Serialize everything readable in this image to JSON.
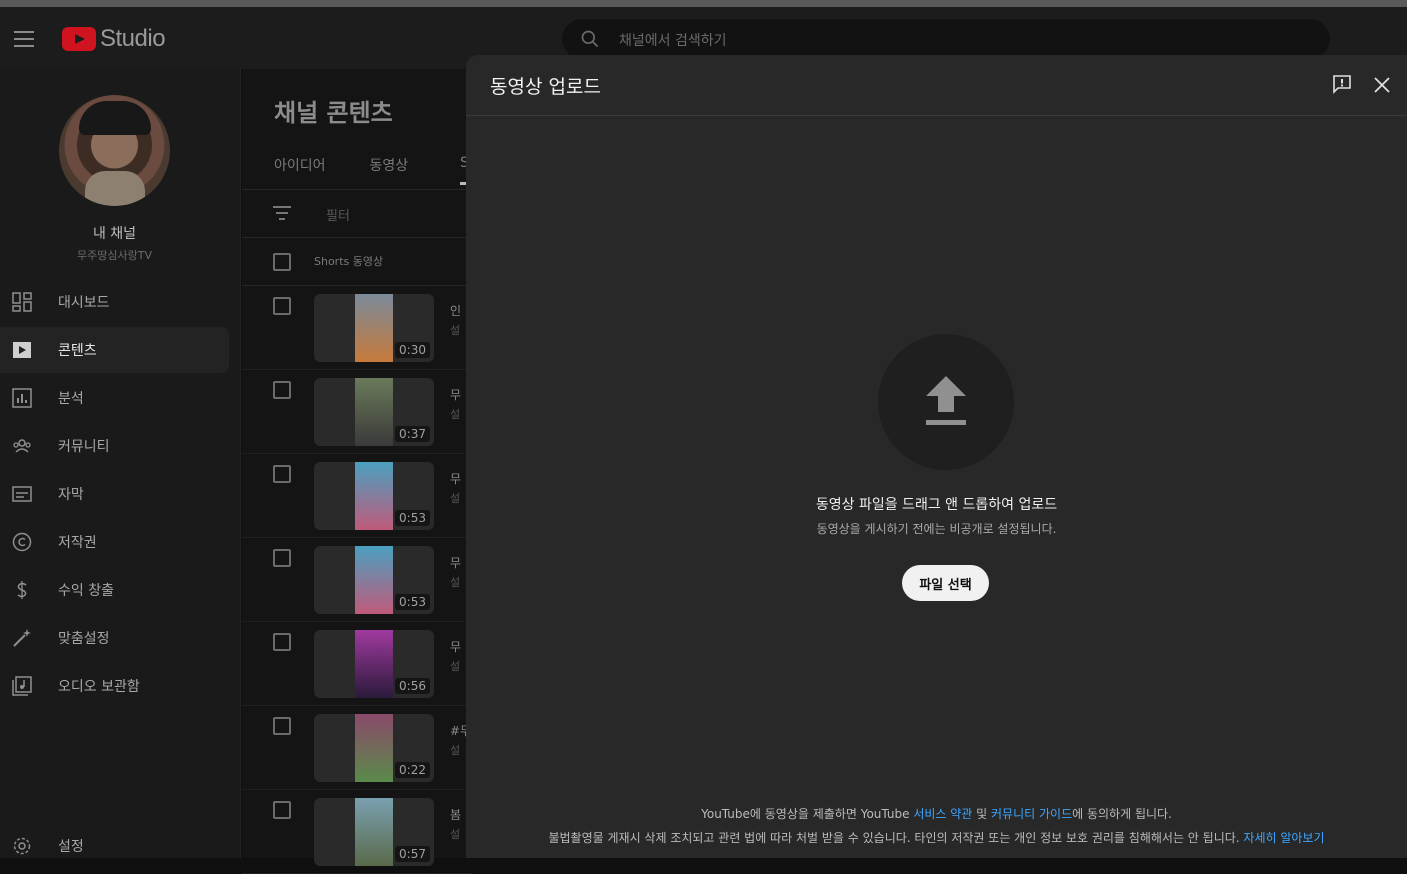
{
  "header": {
    "logo_text": "Studio",
    "search_placeholder": "채널에서 검색하기"
  },
  "sidebar": {
    "channel_name": "내 채널",
    "channel_handle": "무주땅심사랑TV",
    "items": [
      {
        "label": "대시보드",
        "icon": "dashboard-icon"
      },
      {
        "label": "콘텐츠",
        "icon": "content-icon",
        "active": true
      },
      {
        "label": "분석",
        "icon": "analytics-icon"
      },
      {
        "label": "커뮤니티",
        "icon": "community-icon"
      },
      {
        "label": "자막",
        "icon": "subtitles-icon"
      },
      {
        "label": "저작권",
        "icon": "copyright-icon"
      },
      {
        "label": "수익 창출",
        "icon": "monetization-icon"
      },
      {
        "label": "맞춤설정",
        "icon": "customization-icon"
      },
      {
        "label": "오디오 보관함",
        "icon": "audio-library-icon"
      }
    ],
    "settings_label": "설정"
  },
  "main": {
    "title": "채널 콘텐츠",
    "tabs": [
      "아이디어",
      "동영상",
      "S"
    ],
    "filter_label": "필터",
    "list_header": "Shorts 동영상",
    "rows": [
      {
        "duration": "0:30",
        "title": "인",
        "sub": "설",
        "colors": [
          "#7a8a9a",
          "#c77a3a"
        ]
      },
      {
        "duration": "0:37",
        "title": "무",
        "sub": "설",
        "colors": [
          "#6a7a5a",
          "#3a3a3a"
        ]
      },
      {
        "duration": "0:53",
        "title": "무",
        "sub": "설",
        "colors": [
          "#4aa0c0",
          "#c05a7a"
        ]
      },
      {
        "duration": "0:53",
        "title": "무",
        "sub": "설",
        "colors": [
          "#4aa0c0",
          "#c05a7a"
        ]
      },
      {
        "duration": "0:56",
        "title": "무",
        "sub": "설",
        "colors": [
          "#a03aa0",
          "#2a1a3a"
        ]
      },
      {
        "duration": "0:22",
        "title": "#무",
        "sub": "설",
        "colors": [
          "#8a4a6a",
          "#5a8a4a"
        ]
      },
      {
        "duration": "0:57",
        "title": "봄",
        "sub": "설",
        "colors": [
          "#7aa0b0",
          "#5a6a4a"
        ]
      }
    ]
  },
  "dialog": {
    "title": "동영상 업로드",
    "drop_title": "동영상 파일을 드래그 앤 드롭하여 업로드",
    "drop_sub": "동영상을 게시하기 전에는 비공개로 설정됩니다.",
    "select_button": "파일 선택",
    "footer_line1_a": "YouTube에 동영상을 제출하면 YouTube ",
    "footer_link_terms": "서비스 약관",
    "footer_line1_b": " 및 ",
    "footer_link_guidelines": "커뮤니티 가이드",
    "footer_line1_c": "에 동의하게 됩니다.",
    "footer_line2": "불법촬영물 게재시 삭제 조치되고 관련 법에 따라 처벌 받을 수 있습니다. 타인의 저작권 또는 개인 정보 보호 권리를 침해해서는 안 됩니다. ",
    "footer_link_more": "자세히 알아보기"
  }
}
